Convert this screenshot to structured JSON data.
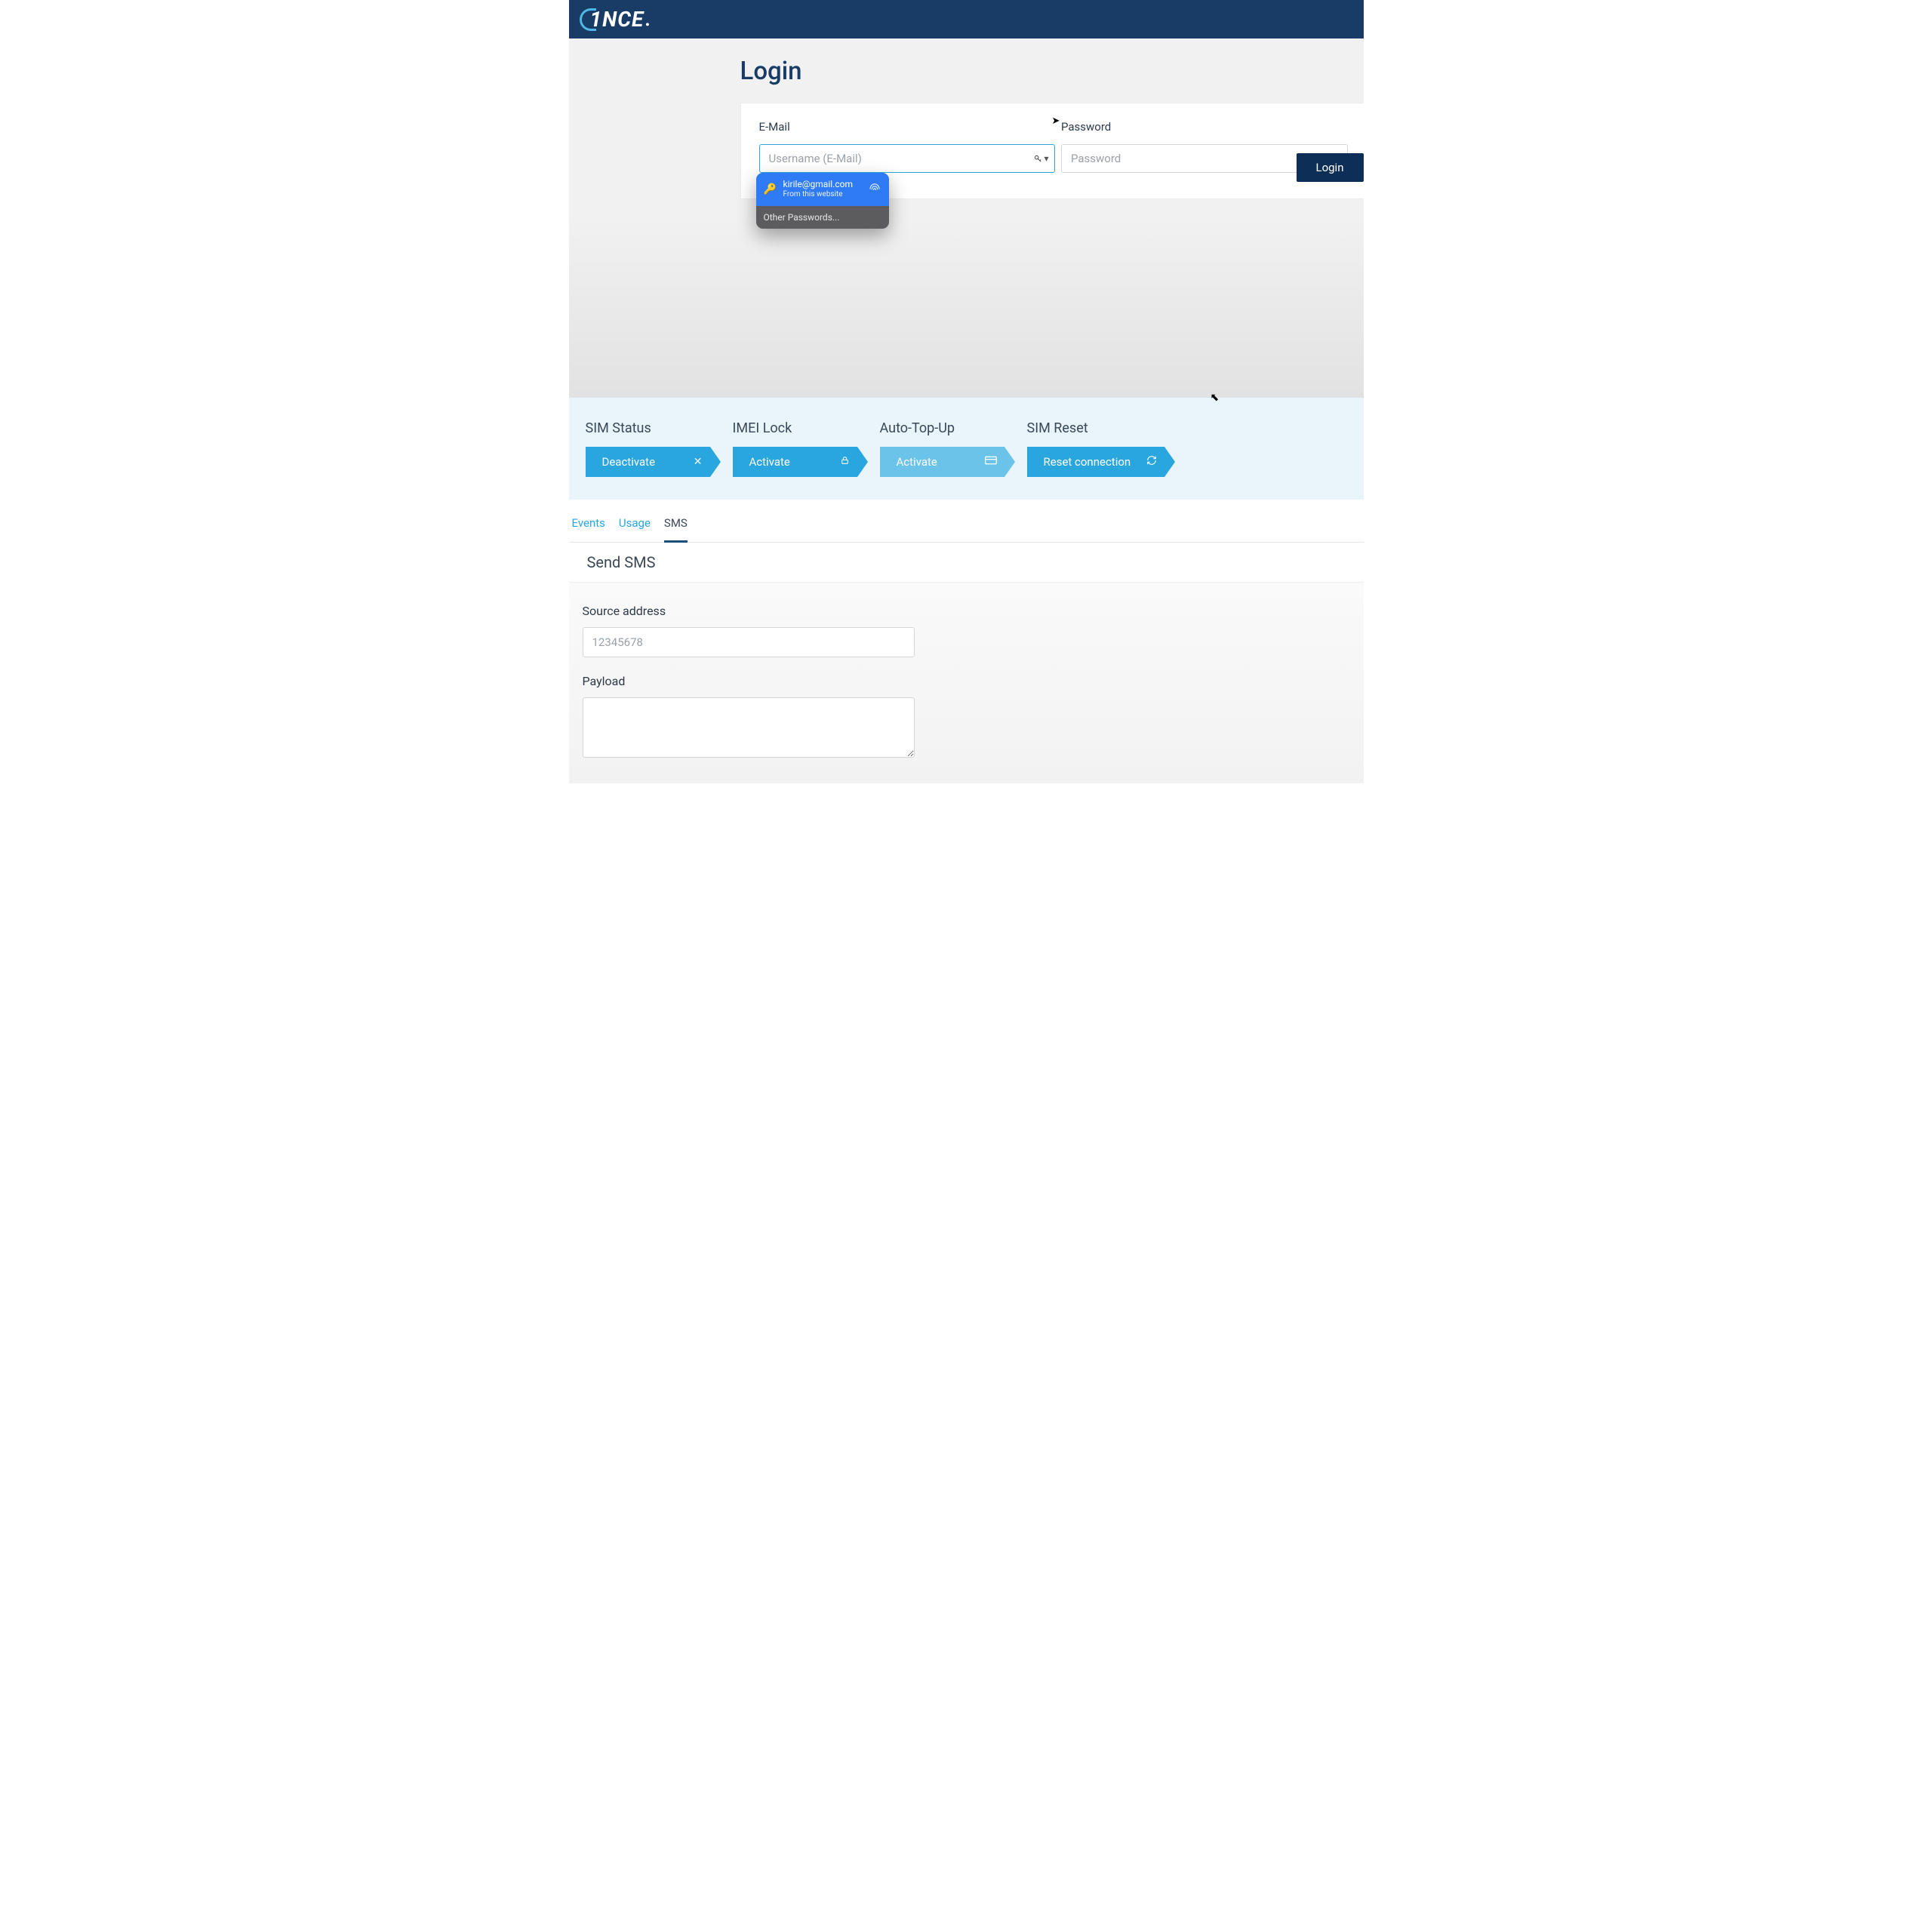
{
  "brand": {
    "name": "1NCE"
  },
  "login": {
    "title": "Login",
    "email_label": "E-Mail",
    "password_label": "Password",
    "email_placeholder": "Username (E-Mail)",
    "password_placeholder": "Password",
    "submit": "Login"
  },
  "autofill": {
    "suggestion_email": "kirile@gmail.com",
    "suggestion_sub": "From this website",
    "other": "Other Passwords..."
  },
  "sim": {
    "status_title": "SIM Status",
    "status_btn": "Deactivate",
    "imei_title": "IMEI Lock",
    "imei_btn": "Activate",
    "topup_title": "Auto-Top-Up",
    "topup_btn": "Activate",
    "reset_title": "SIM Reset",
    "reset_btn": "Reset connection"
  },
  "tabs": {
    "events": "Events",
    "usage": "Usage",
    "sms": "SMS"
  },
  "sms_panel": {
    "heading": "Send SMS",
    "source_label": "Source address",
    "source_placeholder": "12345678",
    "payload_label": "Payload"
  }
}
